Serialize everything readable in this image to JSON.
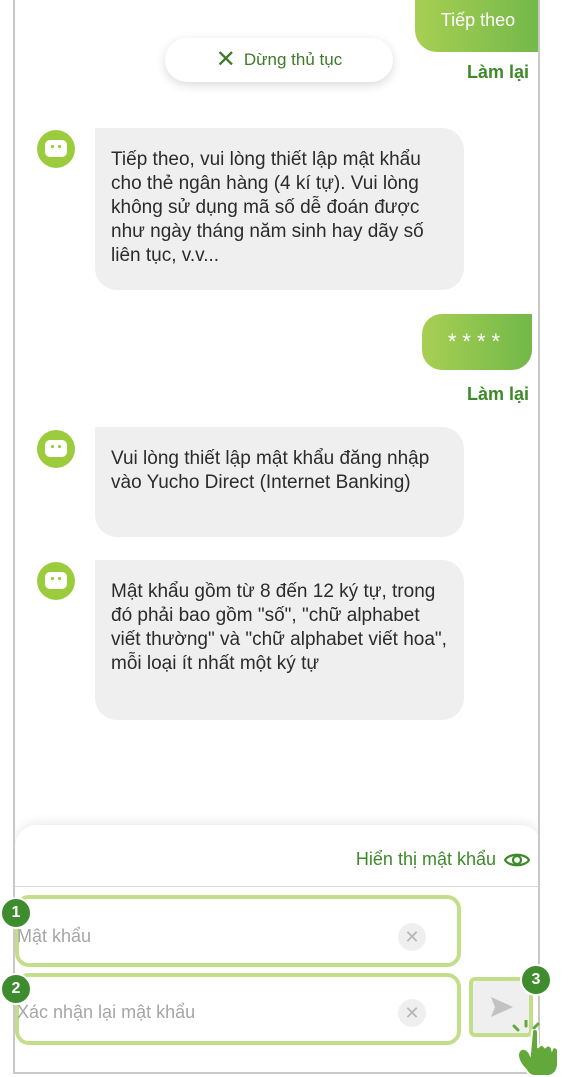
{
  "chat": {
    "top_bubble_text": "Tiếp theo",
    "stop_button": "Dừng thủ tục",
    "redo_label_1": "Làm lại",
    "bot_message_1": "Tiếp theo, vui lòng thiết lập mật khẩu cho thẻ ngân hàng (4 kí tự). Vui lòng không sử dụng mã số dễ đoán được như ngày tháng năm sinh hay dãy số liên tục, v.v...",
    "user_reply": "****",
    "redo_label_2": "Làm lại",
    "bot_message_2": "Vui lòng thiết lập mật khẩu đăng nhập vào Yucho Direct (Internet Banking)",
    "bot_message_3": "Mật khẩu gồm từ 8 đến 12 ký tự, trong đó phải bao gồm \"số\", \"chữ alphabet viết thường\" và \"chữ alphabet viết hoa\", mỗi loại ít nhất một ký tự"
  },
  "input_panel": {
    "show_password": "Hiển thị mật khẩu",
    "password_placeholder": "Mật khẩu",
    "confirm_placeholder": "Xác nhận lại mật khẩu"
  },
  "badges": [
    "1",
    "2",
    "3"
  ],
  "icons": {
    "stop": "close-icon",
    "eye": "eye-icon",
    "clear": "clear-icon",
    "send": "send-icon",
    "bot": "bot-avatar-icon",
    "hand": "pointing-hand-icon"
  },
  "colors": {
    "accent_green": "#3d8a2a",
    "bubble_green": "#8cc34f",
    "highlight": "#c3de8a",
    "badge": "#3e8c2e"
  }
}
